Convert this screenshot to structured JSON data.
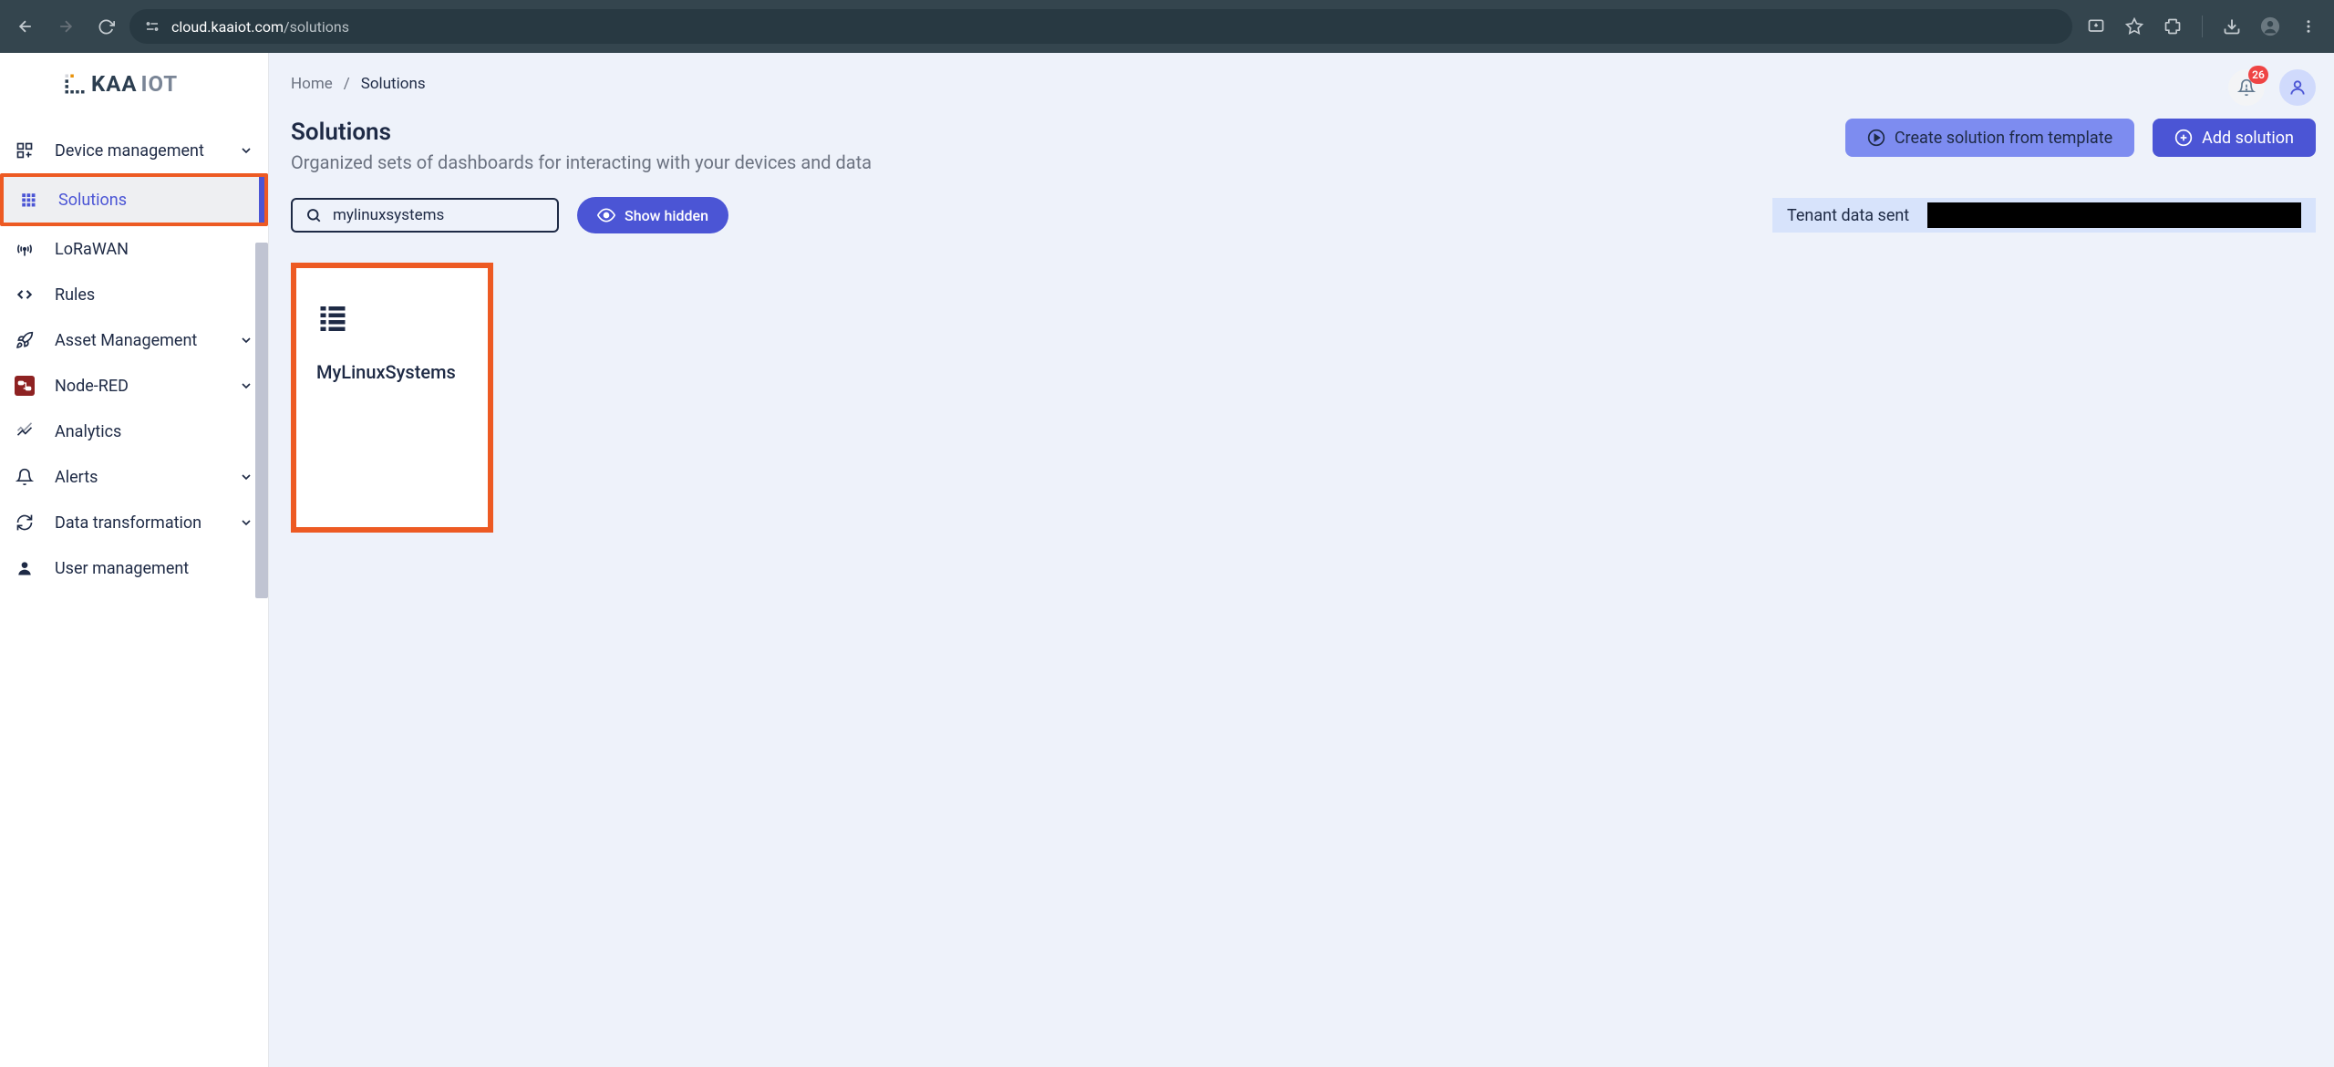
{
  "browser": {
    "url_host": "cloud.kaaiot.com",
    "url_path": "/solutions"
  },
  "logo": {
    "brand_a": "Kaa",
    "brand_b": "IOT"
  },
  "sidebar": {
    "items": [
      {
        "label": "Device management",
        "icon": "grid-plus-icon",
        "expandable": true
      },
      {
        "label": "Solutions",
        "icon": "apps-icon",
        "expandable": false,
        "active": true,
        "highlighted": true
      },
      {
        "label": "LoRaWAN",
        "icon": "antenna-icon",
        "expandable": false
      },
      {
        "label": "Rules",
        "icon": "code-icon",
        "expandable": false
      },
      {
        "label": "Asset Management",
        "icon": "rocket-icon",
        "expandable": true
      },
      {
        "label": "Node-RED",
        "icon": "nodered-icon",
        "expandable": true
      },
      {
        "label": "Analytics",
        "icon": "chart-icon",
        "expandable": false
      },
      {
        "label": "Alerts",
        "icon": "bell-icon",
        "expandable": true
      },
      {
        "label": "Data transformation",
        "icon": "refresh-icon",
        "expandable": true
      },
      {
        "label": "User management",
        "icon": "user-icon",
        "expandable": false
      }
    ]
  },
  "breadcrumb": {
    "home": "Home",
    "sep": "/",
    "current": "Solutions"
  },
  "page": {
    "title": "Solutions",
    "subtitle": "Organized sets of dashboards for interacting with your devices and data"
  },
  "actions": {
    "create_template": "Create solution from template",
    "add_solution": "Add solution"
  },
  "search": {
    "value": "mylinuxsystems"
  },
  "show_hidden": "Show hidden",
  "tenant_label": "Tenant data sent",
  "notifications": {
    "count": "26"
  },
  "cards": [
    {
      "title": "MyLinuxSystems"
    }
  ]
}
